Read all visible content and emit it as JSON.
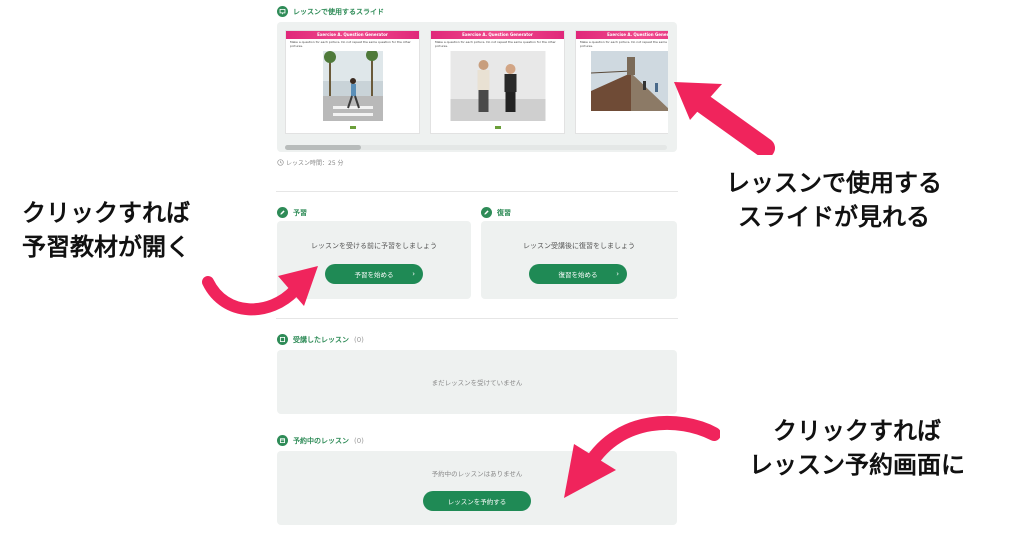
{
  "slides_section": {
    "title": "レッスンで使用するスライド",
    "slides": [
      {
        "header": "Exercise A. Question Generator",
        "text": "Make a question for each picture. Do not repeat the same question for the other pictures."
      },
      {
        "header": "Exercise A. Question Generator",
        "text": "Make a question for each picture. Do not repeat the same question for the other pictures."
      },
      {
        "header": "Exercise A. Question Generator",
        "text": "Make a question for each picture. Do not repeat the same question for the other pictures."
      }
    ],
    "duration": "レッスン時間：25 分"
  },
  "preview": {
    "title": "予習",
    "message": "レッスンを受ける前に予習をしましょう",
    "button": "予習を始める"
  },
  "review": {
    "title": "復習",
    "message": "レッスン受講後に復習をしましょう",
    "button": "復習を始める"
  },
  "taken": {
    "title": "受講したレッスン",
    "count": "(0)",
    "message": "まだレッスンを受けていません"
  },
  "reserved": {
    "title": "予約中のレッスン",
    "count": "(0)",
    "message": "予約中のレッスンはありません",
    "button": "レッスンを予約する"
  },
  "annotations": {
    "slides_line1": "レッスンで使用する",
    "slides_line2": "スライドが見れる",
    "prep_line1": "クリックすれば",
    "prep_line2": "予習教材が開く",
    "reserve_line1": "クリックすれば",
    "reserve_line2": "レッスン予約画面に"
  },
  "colors": {
    "accent": "#1f8a55",
    "annotation_arrow": "#f0245c",
    "panel_box": "#eef1f0"
  }
}
